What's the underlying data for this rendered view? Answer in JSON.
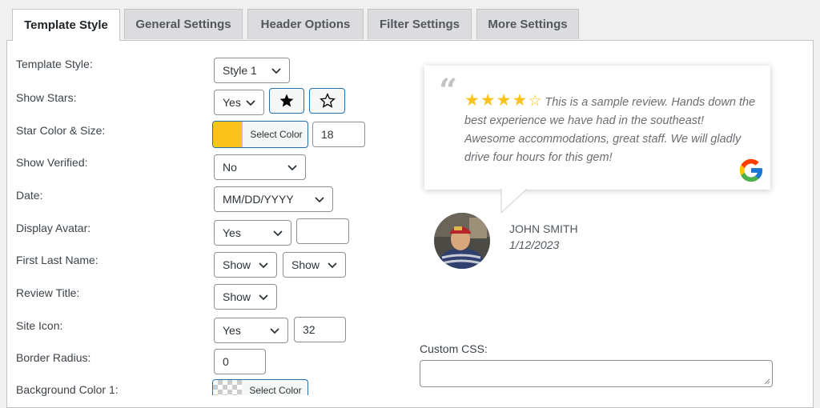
{
  "tabs": [
    {
      "label": "Template Style",
      "active": true
    },
    {
      "label": "General Settings"
    },
    {
      "label": "Header Options"
    },
    {
      "label": "Filter Settings"
    },
    {
      "label": "More Settings"
    }
  ],
  "fields": {
    "template_style": {
      "label": "Template Style:",
      "value": "Style 1"
    },
    "show_stars": {
      "label": "Show Stars:",
      "value": "Yes"
    },
    "star_color_size": {
      "label": "Star Color & Size:",
      "button": "Select Color",
      "color": "#f9c31a",
      "size": "18"
    },
    "show_verified": {
      "label": "Show Verified:",
      "value": "No"
    },
    "date": {
      "label": "Date:",
      "value": "MM/DD/YYYY"
    },
    "display_avatar": {
      "label": "Display Avatar:",
      "value": "Yes",
      "extra": ""
    },
    "first_last_name": {
      "label": "First Last Name:",
      "first": "Show",
      "last": "Show"
    },
    "review_title": {
      "label": "Review Title:",
      "value": "Show"
    },
    "site_icon": {
      "label": "Site Icon:",
      "value": "Yes",
      "size": "32"
    },
    "border_radius": {
      "label": "Border Radius:",
      "value": "0"
    },
    "background_color_1": {
      "label": "Background Color 1:",
      "button": "Select Color"
    }
  },
  "preview": {
    "quote_mark": "“",
    "rating": 4,
    "max_rating": 5,
    "review_text": "This is a sample review. Hands down the best experience we have had in the southeast! Awesome accommodations, great staff. We will gladly drive four hours for this gem!",
    "author_name": "JOHN SMITH",
    "author_date": "1/12/2023",
    "icon": "google-icon"
  },
  "custom_css": {
    "label": "Custom CSS:",
    "value": ""
  },
  "colors": {
    "accent": "#2271b1",
    "star": "#f9c31a"
  }
}
